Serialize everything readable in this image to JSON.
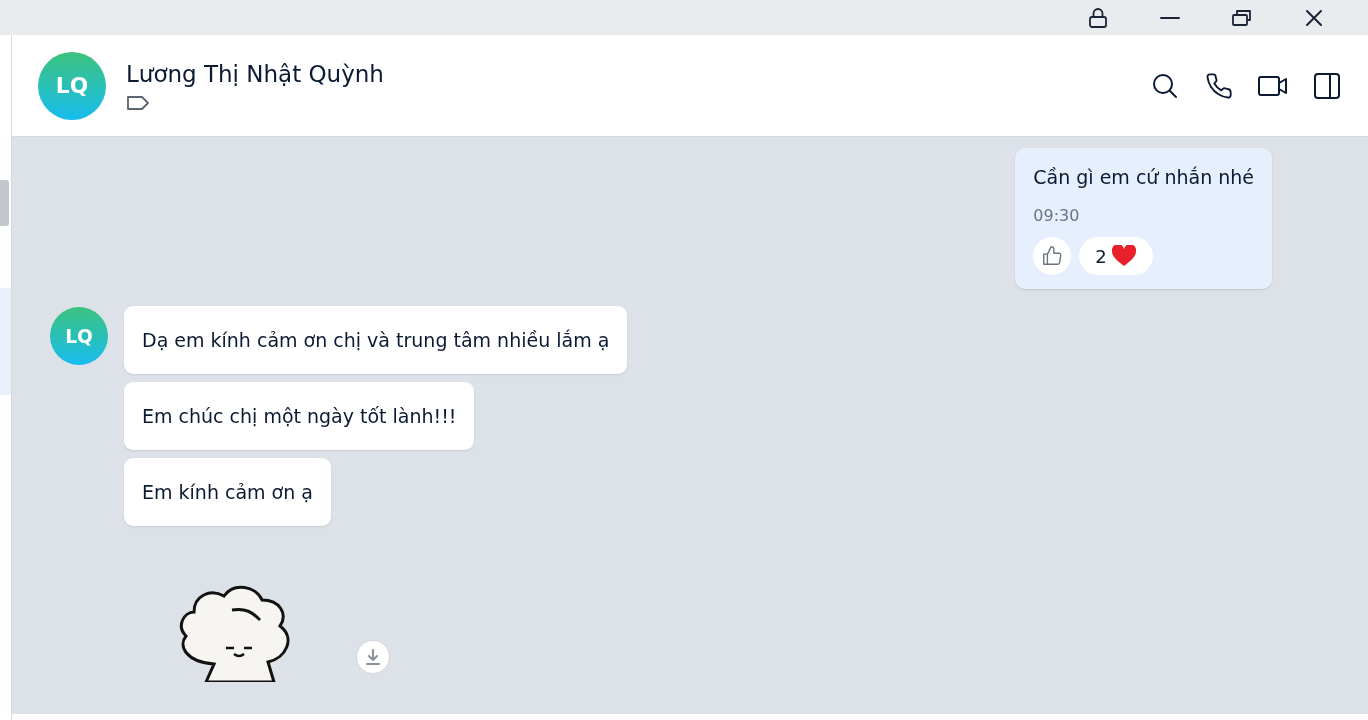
{
  "header": {
    "avatar_initials": "LQ",
    "name": "Lương Thị Nhật Quỳnh"
  },
  "messages": [
    {
      "kind": "sent",
      "text": "Cần gì em cứ nhắn nhé",
      "time": "09:30",
      "reaction_count": "2"
    },
    {
      "kind": "received",
      "avatar_initials": "LQ",
      "text": "Dạ em kính cảm ơn chị và trung tâm nhiều lắm ạ"
    },
    {
      "kind": "received",
      "text": "Em chúc chị một ngày tốt lành!!!"
    },
    {
      "kind": "received",
      "text": "Em kính cảm ơn ạ"
    },
    {
      "kind": "sticker"
    }
  ]
}
